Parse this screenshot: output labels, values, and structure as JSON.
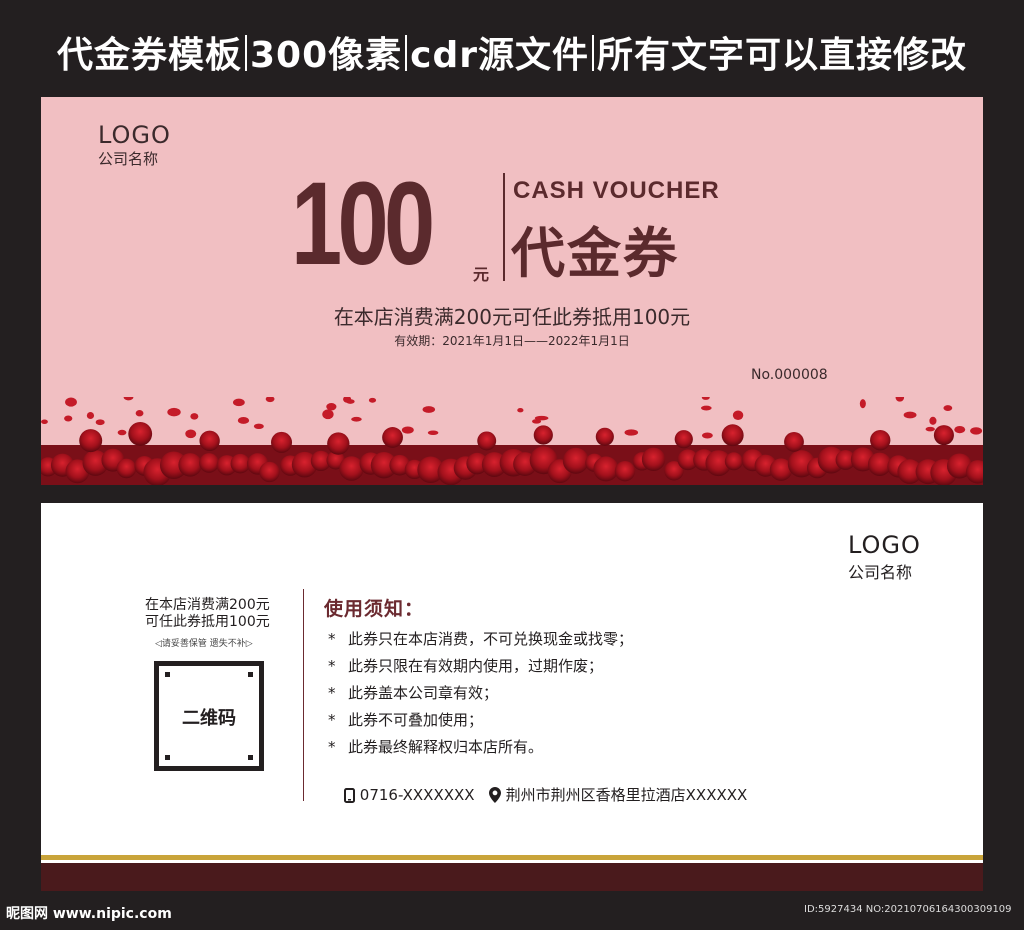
{
  "header": {
    "title_parts": [
      "代金券模板",
      "300像素",
      "cdr源文件",
      "所有文字可以直接修改"
    ]
  },
  "front": {
    "logo": "LOGO",
    "company": "公司名称",
    "amount": "100",
    "unit": "元",
    "cash_voucher": "CASH VOUCHER",
    "voucher_cn": "代金券",
    "condition": "在本店消费满200元可任此券抵用100元",
    "validity": "有效期：2021年1月1日——2022年1月1日",
    "number": "No.000008"
  },
  "back": {
    "logo": "LOGO",
    "company": "公司名称",
    "condition_line1": "在本店消费满200元",
    "condition_line2": "可任此券抵用100元",
    "keep_note": "◁请妥善保管  遗失不补▷",
    "qr_label": "二维码",
    "notice_title": "使用须知：",
    "rules": [
      "此券只在本店消费，不可兑换现金或找零；",
      "此券只限在有效期内使用，过期作废；",
      "此券盖本公司章有效；",
      "此券不可叠加使用；",
      "此券最终解释权归本店所有。"
    ],
    "phone": "0716-XXXXXXX",
    "address": "荆州市荆州区香格里拉酒店XXXXXX"
  },
  "watermark": {
    "site": "昵图网 www.nipic.com",
    "id": "ID:5927434 NO:20210706164300309109"
  },
  "colors": {
    "page_bg": "#231f20",
    "front_bg": "#f1bfc2",
    "accent_brown": "#5b2a2d",
    "rose_red": "#b0161f",
    "gold": "#c9a43a",
    "band": "#4a1a1c"
  }
}
